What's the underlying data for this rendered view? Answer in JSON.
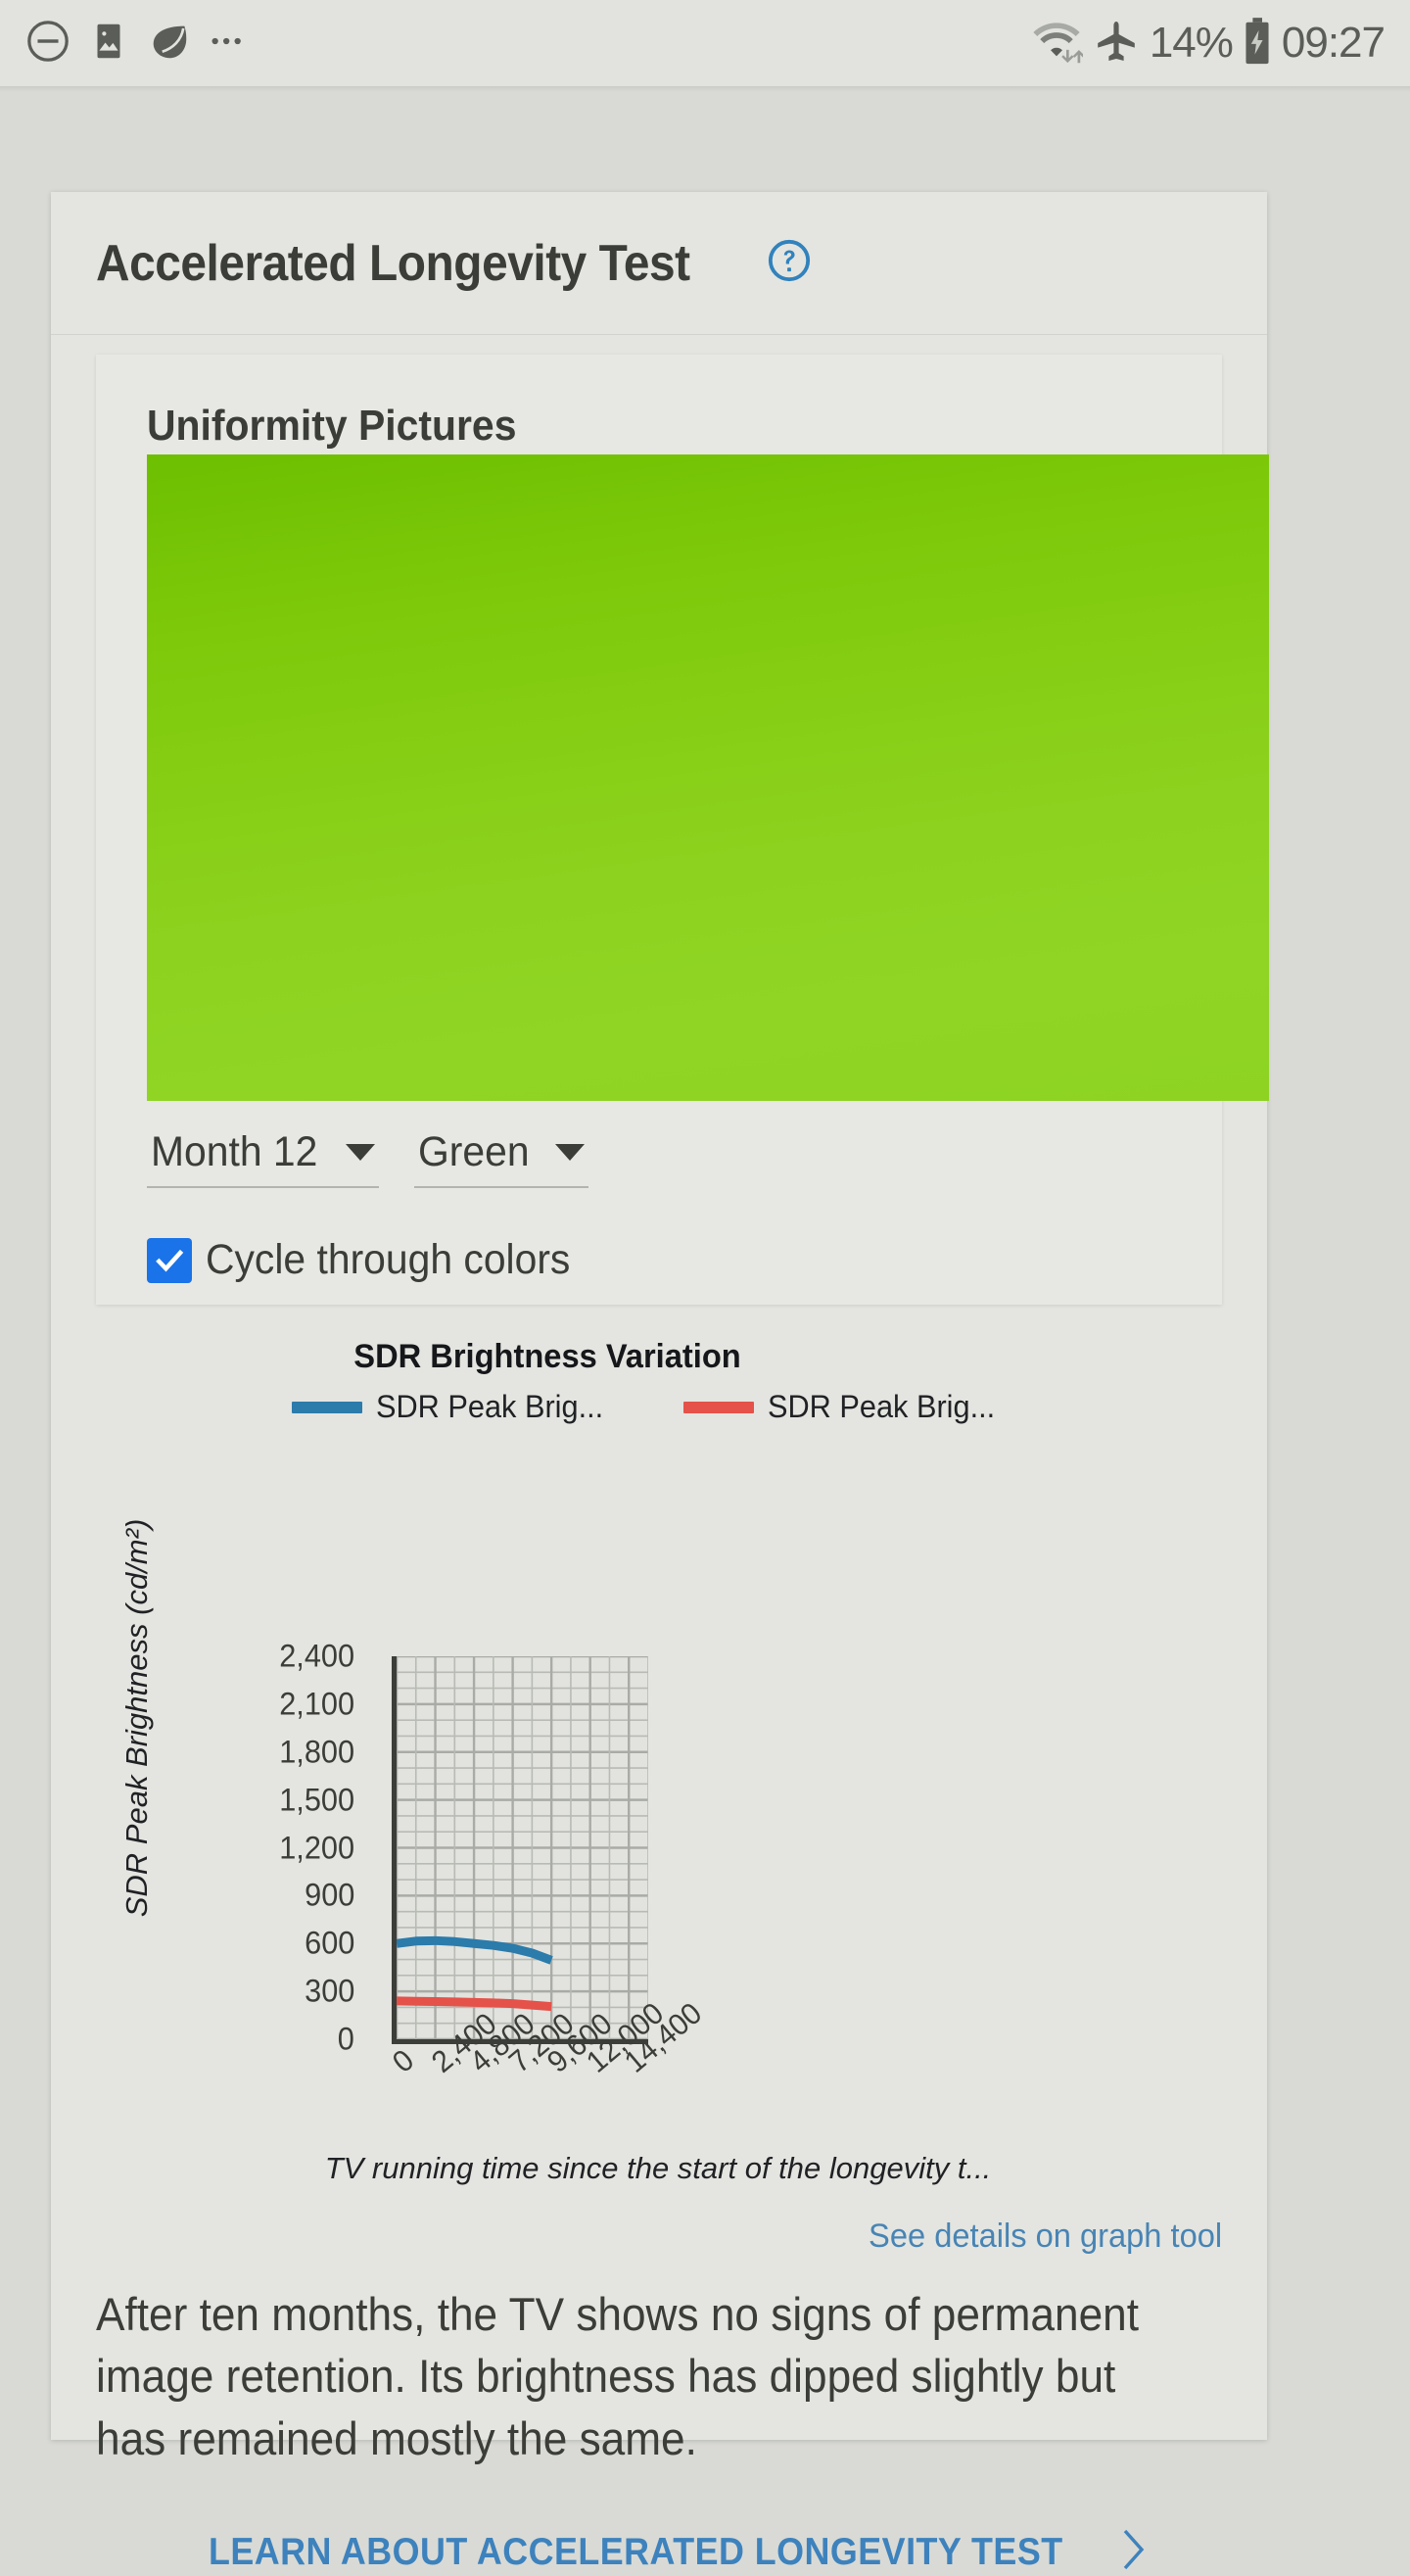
{
  "status_bar": {
    "left_icons": [
      "do-not-disturb-icon",
      "image-icon",
      "leaf-icon",
      "more-icon"
    ],
    "wifi_icon": "wifi-icon",
    "airplane_icon": "airplane-mode-icon",
    "battery_percent": "14%",
    "battery_icon": "battery-charging-icon",
    "time": "09:27"
  },
  "card": {
    "title": "Accelerated Longevity Test",
    "help_icon": "help-circle-icon"
  },
  "uniformity": {
    "section_title": "Uniformity Pictures",
    "image_alt": "green-uniformity-picture",
    "month_dropdown": "Month 12",
    "color_dropdown": "Green",
    "checkbox_label": "Cycle through colors",
    "checkbox_checked": true,
    "checkbox_color": "#1a73e8",
    "image_color_top": "#6dbf01",
    "image_color_bottom": "#8ed322"
  },
  "chart_data": {
    "type": "line",
    "title": "SDR Brightness Variation",
    "xlabel": "TV running time since the start of the longevity t...",
    "ylabel": "SDR Peak Brightness (cd/m²)",
    "xlim": [
      0,
      15600
    ],
    "ylim": [
      0,
      2400
    ],
    "xticks": [
      "0",
      "2,400",
      "4,800",
      "7,200",
      "9,600",
      "12,000",
      "14,400"
    ],
    "xtick_values": [
      0,
      2400,
      4800,
      7200,
      9600,
      12000,
      14400
    ],
    "yticks": [
      "0",
      "300",
      "600",
      "900",
      "1,200",
      "1,500",
      "1,800",
      "2,100",
      "2,400"
    ],
    "ytick_values": [
      0,
      300,
      600,
      900,
      1200,
      1500,
      1800,
      2100,
      2400
    ],
    "grid": true,
    "legend_position": "top",
    "series": [
      {
        "name": "SDR Peak Brig...",
        "color": "#2b7bab",
        "x": [
          0,
          1200,
          2400,
          3600,
          4800,
          6000,
          7200,
          8400,
          9600
        ],
        "values": [
          600,
          615,
          618,
          612,
          600,
          588,
          570,
          540,
          495
        ]
      },
      {
        "name": "SDR Peak Brig...",
        "color": "#e4524a",
        "x": [
          0,
          1200,
          2400,
          3600,
          4800,
          6000,
          7200,
          8400,
          9600
        ],
        "values": [
          240,
          238,
          236,
          234,
          231,
          228,
          223,
          214,
          205
        ]
      }
    ]
  },
  "graph_tool_link": "See details on graph tool",
  "body_copy": "After ten months, the TV shows no signs of permanent image retention. Its brightness has dipped slightly but has remained mostly the same.",
  "cta": {
    "label": "LEARN ABOUT ACCELERATED LONGEVITY TEST",
    "chevron": "chevron-right-icon"
  }
}
